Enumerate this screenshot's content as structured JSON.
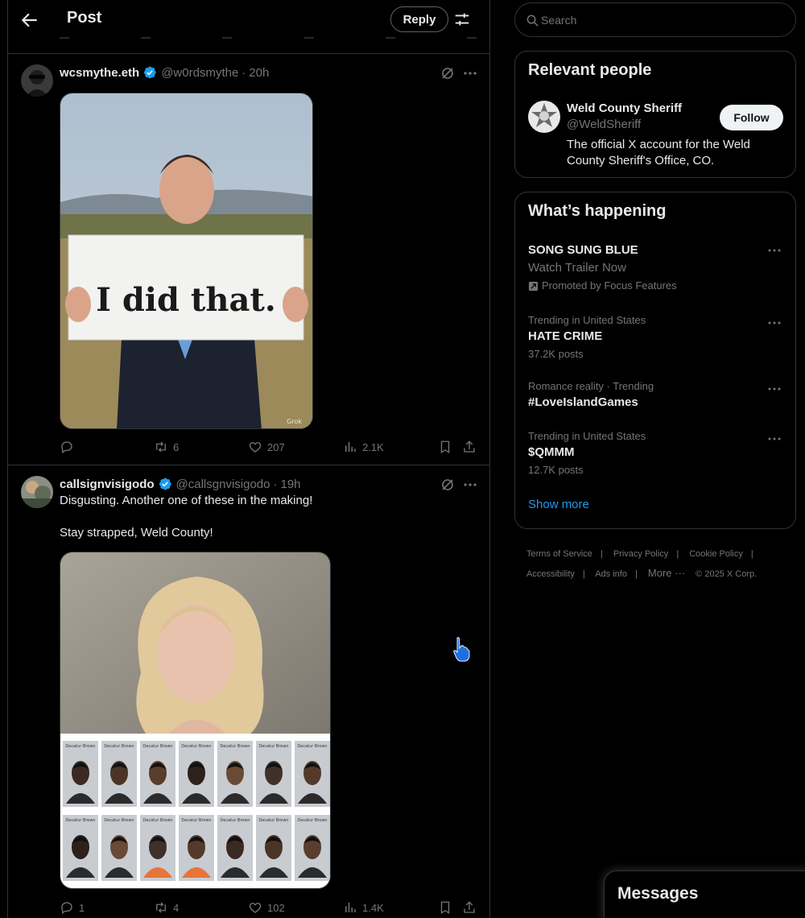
{
  "header": {
    "title": "Post",
    "reply_label": "Reply"
  },
  "tweets": [
    {
      "name": "wcsmythe.eth",
      "handle": "@w0rdsmythe",
      "time": "20h",
      "image_sign_text": "I did that.",
      "watermark": "Grok",
      "stats": {
        "replies": "",
        "reposts": "6",
        "likes": "207",
        "views": "2.1K"
      }
    },
    {
      "name": "callsignvisigodo",
      "handle": "@callsgnvisigodo",
      "time": "19h",
      "text": "Disgusting. Another one of these in the making!\n\nStay strapped, Weld County!",
      "mugshot_header": "Decatur Brown",
      "stats": {
        "replies": "1",
        "reposts": "4",
        "likes": "102",
        "views": "1.4K"
      }
    }
  ],
  "search": {
    "placeholder": "Search"
  },
  "relevant_people": {
    "title": "Relevant people",
    "person": {
      "name": "Weld County Sheriff",
      "handle": "@WeldSheriff",
      "bio": "The official X account for the Weld County Sheriff's Office, CO.",
      "follow_label": "Follow"
    }
  },
  "whats_happening": {
    "title": "What’s happening",
    "trends": [
      {
        "topic": "SONG SUNG BLUE",
        "sub": "Watch Trailer Now",
        "promo": "Promoted by Focus Features"
      },
      {
        "context": "Trending in United States",
        "topic": "HATE CRIME",
        "posts": "37.2K posts"
      },
      {
        "context": "Romance reality · Trending",
        "topic": "#LoveIslandGames"
      },
      {
        "context": "Trending in United States",
        "topic": "$QMMM",
        "posts": "12.7K posts"
      }
    ],
    "show_more": "Show more"
  },
  "footer": {
    "links": [
      "Terms of Service",
      "Privacy Policy",
      "Cookie Policy",
      "Accessibility",
      "Ads info",
      "More ···"
    ],
    "copyright": "© 2025 X Corp."
  },
  "messages": {
    "title": "Messages"
  },
  "colors": {
    "accent": "#1d9bf0",
    "background": "#000000",
    "muted": "#71767b",
    "border": "#2f3336"
  }
}
